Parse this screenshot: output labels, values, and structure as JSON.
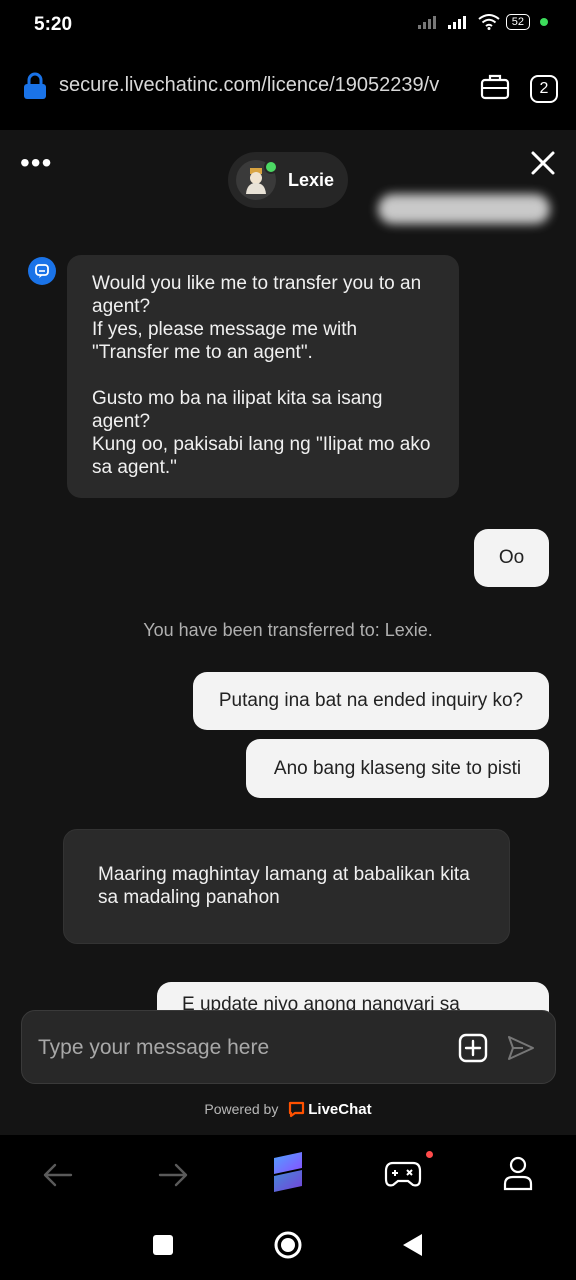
{
  "status_bar": {
    "time": "5:20",
    "battery": "52"
  },
  "browser": {
    "url": "secure.livechatinc.com/licence/19052239/v",
    "tabs_count": "2"
  },
  "chat_header": {
    "agent_name": "Lexie"
  },
  "messages": [
    {
      "from": "bot",
      "text": "Would you like me to transfer you to an agent?\nIf yes, please message me with \"Transfer me to an agent\".\n\nGusto mo ba na ilipat kita sa isang agent?\nKung oo, pakisabi lang ng \"Ilipat mo ako sa agent.\""
    },
    {
      "from": "user",
      "text": "Oo"
    },
    {
      "from": "system",
      "text": "You have been transferred to: Lexie."
    },
    {
      "from": "user",
      "text": "Putang ina bat na ended inquiry ko?"
    },
    {
      "from": "user",
      "text": "Ano bang klaseng site to pisti"
    },
    {
      "from": "agent",
      "text": "Maaring maghintay lamang at babalikan kita sa madaling panahon"
    },
    {
      "from": "user",
      "text": "E update niyo anong nangyari sa"
    }
  ],
  "composer": {
    "placeholder": "Type your message here"
  },
  "footer": {
    "powered_by": "Powered by",
    "brand": "LiveChat"
  },
  "colors": {
    "accent": "#1a73e8",
    "livechat_orange": "#ff5100",
    "online": "#4cd964"
  },
  "icons": [
    "lock-icon",
    "briefcase-icon",
    "close-icon",
    "menu-dots-icon",
    "chat-bot-icon",
    "attach-icon",
    "send-icon",
    "back-arrow-icon",
    "forward-arrow-icon",
    "app-logo-icon",
    "gamepad-icon",
    "profile-icon",
    "square-icon",
    "home-circle-icon",
    "back-triangle-icon"
  ]
}
